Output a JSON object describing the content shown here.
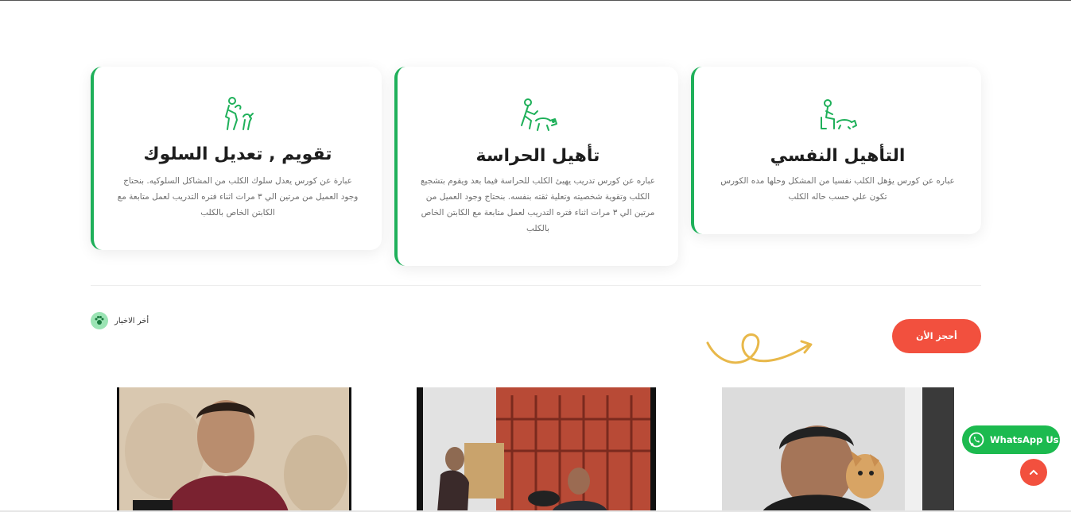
{
  "services": [
    {
      "icon": "person-dog-training-icon",
      "title": "تقويم , تعديل السلوك",
      "description": "عبارة عن كورس يعدل سلوك الكلب من المشاكل السلوكيه. بنحتاج وجود العميل من مرتين الي ٣ مرات اثناء فتره التدريب لعمل متابعة مع الكابتن الخاص بالكلب"
    },
    {
      "icon": "guard-dog-icon",
      "title": "تأهيل الحراسة",
      "description": "عباره عن كورس تدريب يهيئ الكلب للحراسة فيما بعد ويقوم بتشجيع الكلب وتقوية شخصيته وتعلية ثقته بنفسه. بنحتاج وجود العميل من مرتين الي ٣ مرات اثناء فتره التدريب لعمل متابعة مع الكابتن الخاص بالكلب"
    },
    {
      "icon": "person-sitting-dog-icon",
      "title": "التأهيل النفسي",
      "description": "عباره عن كورس يؤهل الكلب نفسيا من المشكل وحلها مده الكورس تكون علي حسب حاله الكلب"
    }
  ],
  "news": {
    "label": "أخر الاخبار",
    "icon": "paw-icon"
  },
  "cta": {
    "label": "أحجز الأن"
  },
  "whatsapp": {
    "label": "WhatsApp Us",
    "icon": "whatsapp-icon"
  },
  "scroll_top": {
    "icon": "chevron-up-icon"
  },
  "videos": [
    {
      "thumbnail": "man-talking-to-camera"
    },
    {
      "thumbnail": "men-with-dog-at-gate"
    },
    {
      "thumbnail": "man-holding-chihuahua"
    }
  ],
  "colors": {
    "accent_green": "#1fb05a",
    "cta_red": "#f2503e",
    "whatsapp_green": "#1cba4f",
    "deco_yellow": "#e8b84a"
  }
}
